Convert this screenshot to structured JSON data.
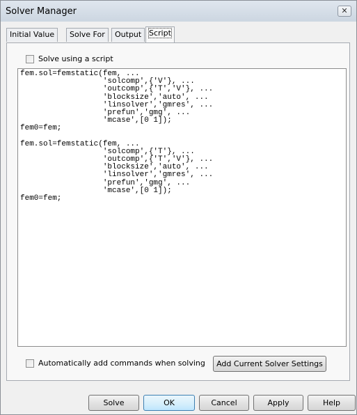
{
  "window": {
    "title": "Solver Manager",
    "close_icon": "close-icon"
  },
  "tabs": [
    {
      "label": "Initial Value"
    },
    {
      "label": "Solve For"
    },
    {
      "label": "Output"
    },
    {
      "label": "Script",
      "active": true
    }
  ],
  "script_panel": {
    "solve_using_script_label": "Solve using a script",
    "solve_using_script_checked": false,
    "script_lines": [
      "fem.sol=femstatic(fem, ...",
      "                  'solcomp',{'V'}, ...",
      "                  'outcomp',{'T','V'}, ...",
      "                  'blocksize','auto', ...",
      "                  'linsolver','gmres', ...",
      "                  'prefun','gmg', ...",
      "                  'mcase',[0 1]);",
      "fem0=fem;",
      "",
      "fem.sol=femstatic(fem, ...",
      "                  'solcomp',{'T'}, ...",
      "                  'outcomp',{'T','V'}, ...",
      "                  'blocksize','auto', ...",
      "                  'linsolver','gmres', ...",
      "                  'prefun','gmg', ...",
      "                  'mcase',[0 1]);",
      "fem0=fem;"
    ],
    "auto_add_label": "Automatically add commands when solving",
    "auto_add_checked": false,
    "add_settings_button": "Add Current Solver Settings"
  },
  "footer_buttons": {
    "solve": "Solve",
    "ok": "OK",
    "cancel": "Cancel",
    "apply": "Apply",
    "help": "Help"
  }
}
